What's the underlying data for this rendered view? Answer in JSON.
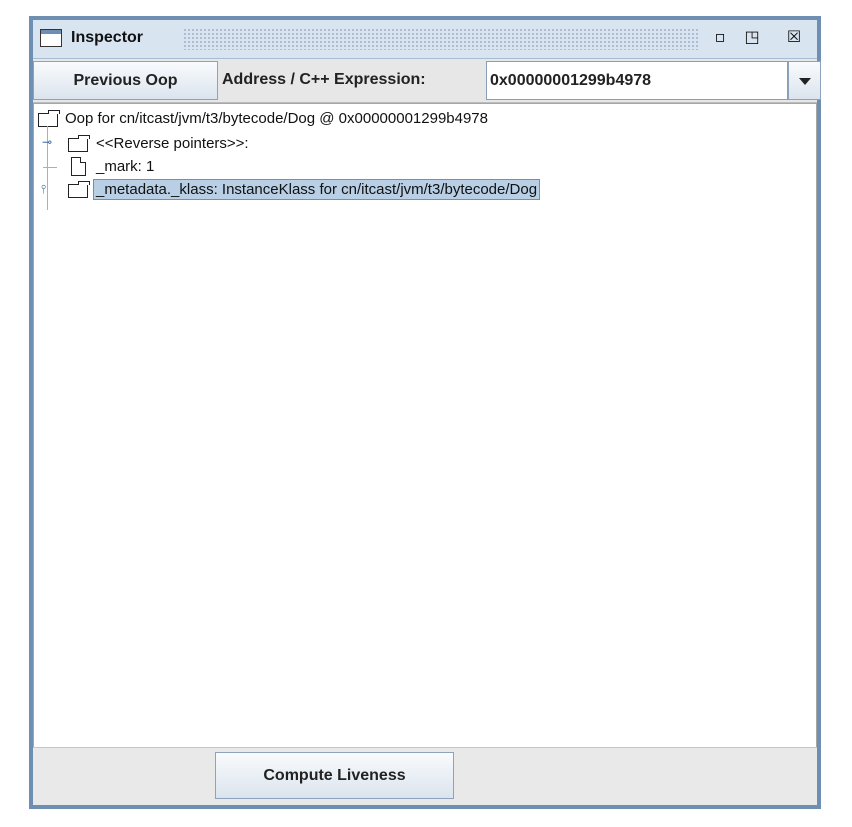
{
  "window": {
    "title": "Inspector",
    "controls": [
      "minimize-icon",
      "maximize-icon",
      "close-icon"
    ]
  },
  "toolbar": {
    "previous_oop_label": "Previous Oop",
    "address_label": "Address / C++ Expression:",
    "address_value": "0x00000001299b4978"
  },
  "tree": {
    "root": "Oop for cn/itcast/jvm/t3/bytecode/Dog @ 0x00000001299b4978",
    "items": [
      {
        "label": "<<Reverse pointers>>:",
        "type": "folder",
        "expanded": false
      },
      {
        "label": "_mark: 1",
        "type": "leaf"
      },
      {
        "label": "_metadata._klass: InstanceKlass for cn/itcast/jvm/t3/bytecode/Dog",
        "type": "folder",
        "expanded": false,
        "selected": true
      }
    ]
  },
  "footer": {
    "compute_liveness_label": "Compute Liveness"
  }
}
